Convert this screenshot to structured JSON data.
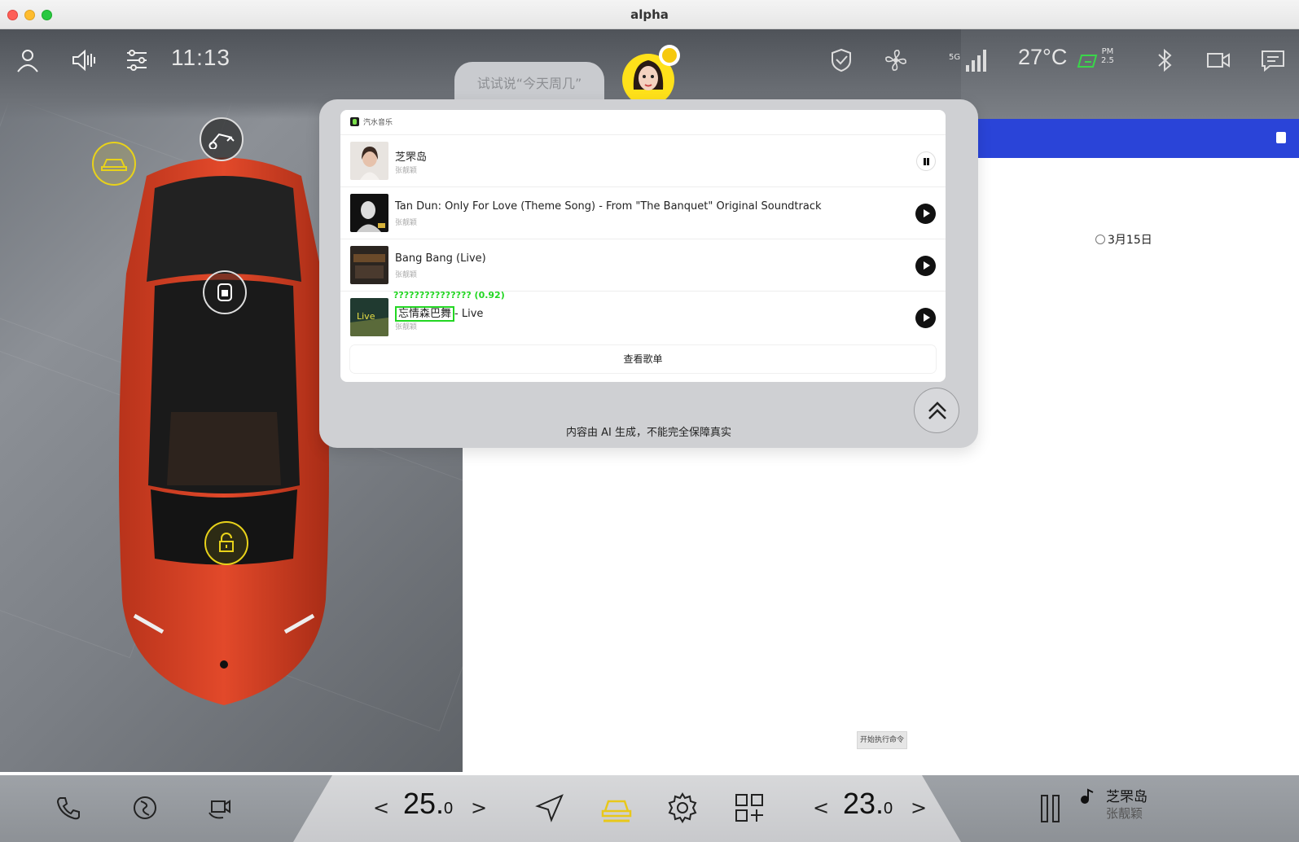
{
  "window": {
    "title": "alpha"
  },
  "status_bar": {
    "time": "11:13",
    "temperature": "27°C",
    "pm_label": "PM",
    "pm_value": "2.5",
    "network": "5G",
    "icons": [
      "user-icon",
      "volume-icon",
      "sliders-icon",
      "shield-icon",
      "fan-icon",
      "signal-icon",
      "battery-leaf-icon",
      "bluetooth-icon",
      "camera-icon",
      "message-icon"
    ]
  },
  "voice": {
    "hint": "试试说“今天周几”"
  },
  "music_card": {
    "app_name": "汽水音乐",
    "tracks": [
      {
        "title": "芝罘岛",
        "artist": "张靓颖",
        "state": "playing"
      },
      {
        "title": "Tan Dun: Only For Love (Theme Song) - From \"The Banquet\" Original Soundtrack",
        "artist": "张靓颖",
        "state": "paused"
      },
      {
        "title": "Bang Bang (Live)",
        "artist": "张靓颖",
        "state": "paused"
      },
      {
        "title_highlighted": "忘情森巴舞",
        "title_rest": "- Live",
        "artist": "张靓颖",
        "state": "paused",
        "ocr_label": "??????????????? (0.92)"
      }
    ],
    "view_list_label": "查看歌单"
  },
  "disclaimer": "内容由 AI 生成，不能完全保障真实",
  "right_panel": {
    "date_option": "3月15日",
    "exec_button": "开始执行命令"
  },
  "dock": {
    "left_temp_main": "25.",
    "left_temp_dec": "0",
    "right_temp_main": "23.",
    "right_temp_dec": "0",
    "prev_symbol": "<",
    "next_symbol": ">",
    "now_playing_title": "芝罘岛",
    "now_playing_artist": "张靓颖"
  },
  "colors": {
    "accent_yellow": "#e8d21a",
    "blue_bar": "#2a44d8",
    "ocr_green": "#22d622"
  }
}
